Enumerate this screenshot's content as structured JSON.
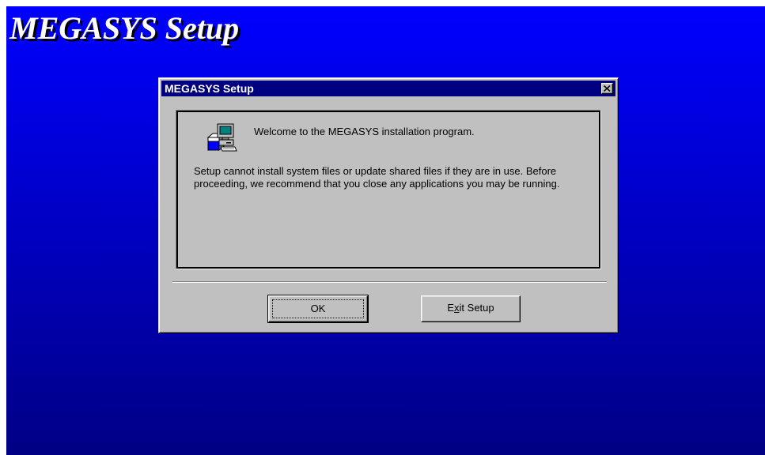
{
  "background": {
    "title": "MEGASYS Setup",
    "gradient_top": "#0000ff",
    "gradient_bottom": "#000084"
  },
  "dialog": {
    "title": "MEGASYS Setup",
    "titlebar_color": "#000080",
    "close_icon": "close-icon",
    "setup_icon": "computer-setup-icon",
    "welcome": "Welcome to the MEGASYS installation program.",
    "notice": "Setup cannot install system files or update shared files if they are in use. Before proceeding, we recommend that you close any applications you may be running.",
    "buttons": {
      "ok_label": "OK",
      "exit_label_prefix": "E",
      "exit_label_mnemonic": "x",
      "exit_label_suffix": "it Setup"
    }
  }
}
